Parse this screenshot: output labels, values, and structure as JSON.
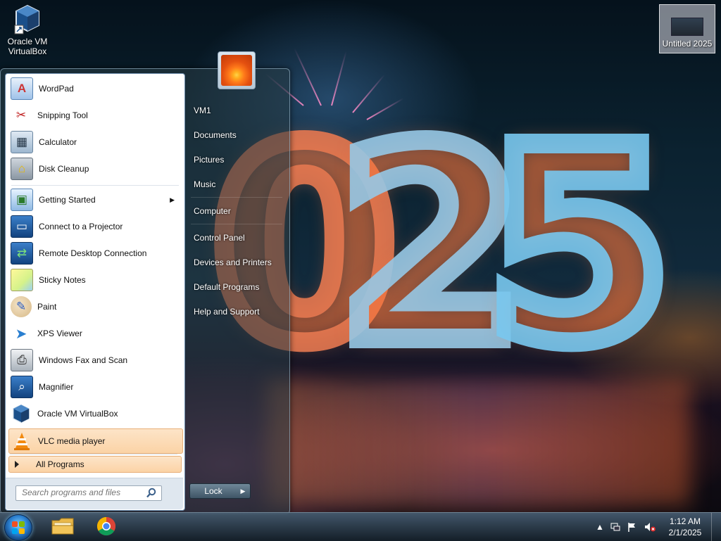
{
  "desktop": {
    "icons": [
      {
        "label_line1": "Oracle VM",
        "label_line2": "VirtualBox",
        "icon": "virtualbox-cube-icon"
      },
      {
        "label": "Untitled 2025",
        "icon": "image-thumbnail-icon"
      }
    ],
    "wallpaper_digits": [
      "0",
      "2",
      "5"
    ]
  },
  "start_menu": {
    "programs": [
      {
        "label": "WordPad",
        "icon": "wordpad-icon"
      },
      {
        "label": "Snipping Tool",
        "icon": "scissors-icon"
      },
      {
        "label": "Calculator",
        "icon": "calculator-icon"
      },
      {
        "label": "Disk Cleanup",
        "icon": "disk-cleanup-icon"
      },
      {
        "label": "Getting Started",
        "icon": "getting-started-icon",
        "has_submenu": true
      },
      {
        "label": "Connect to a Projector",
        "icon": "projector-icon"
      },
      {
        "label": "Remote Desktop Connection",
        "icon": "remote-desktop-icon"
      },
      {
        "label": "Sticky Notes",
        "icon": "sticky-notes-icon"
      },
      {
        "label": "Paint",
        "icon": "paint-palette-icon"
      },
      {
        "label": "XPS Viewer",
        "icon": "xps-viewer-icon"
      },
      {
        "label": "Windows Fax and Scan",
        "icon": "fax-icon"
      },
      {
        "label": "Magnifier",
        "icon": "magnifier-icon"
      },
      {
        "label": "Oracle VM VirtualBox",
        "icon": "virtualbox-cube-icon"
      },
      {
        "label": "VLC media player",
        "icon": "vlc-cone-icon",
        "highlighted": true
      }
    ],
    "all_programs_label": "All Programs",
    "search": {
      "placeholder": "Search programs and files"
    },
    "right_items": [
      {
        "label": "VM1"
      },
      {
        "label": "Documents"
      },
      {
        "label": "Pictures"
      },
      {
        "label": "Music"
      },
      {
        "label": "Computer"
      },
      {
        "label": "Control Panel"
      },
      {
        "label": "Devices and Printers"
      },
      {
        "label": "Default Programs"
      },
      {
        "label": "Help and Support"
      }
    ],
    "lock_label": "Lock"
  },
  "taskbar": {
    "pinned": [
      {
        "icon": "file-explorer-folder-icon"
      },
      {
        "icon": "chrome-icon"
      }
    ],
    "tray": {
      "time": "1:12 AM",
      "date": "2/1/2025"
    }
  },
  "colors": {
    "highlight": "#fbd3a6",
    "taskbar": "#2a3a4a",
    "menu_glass": "#3c5a6a"
  }
}
